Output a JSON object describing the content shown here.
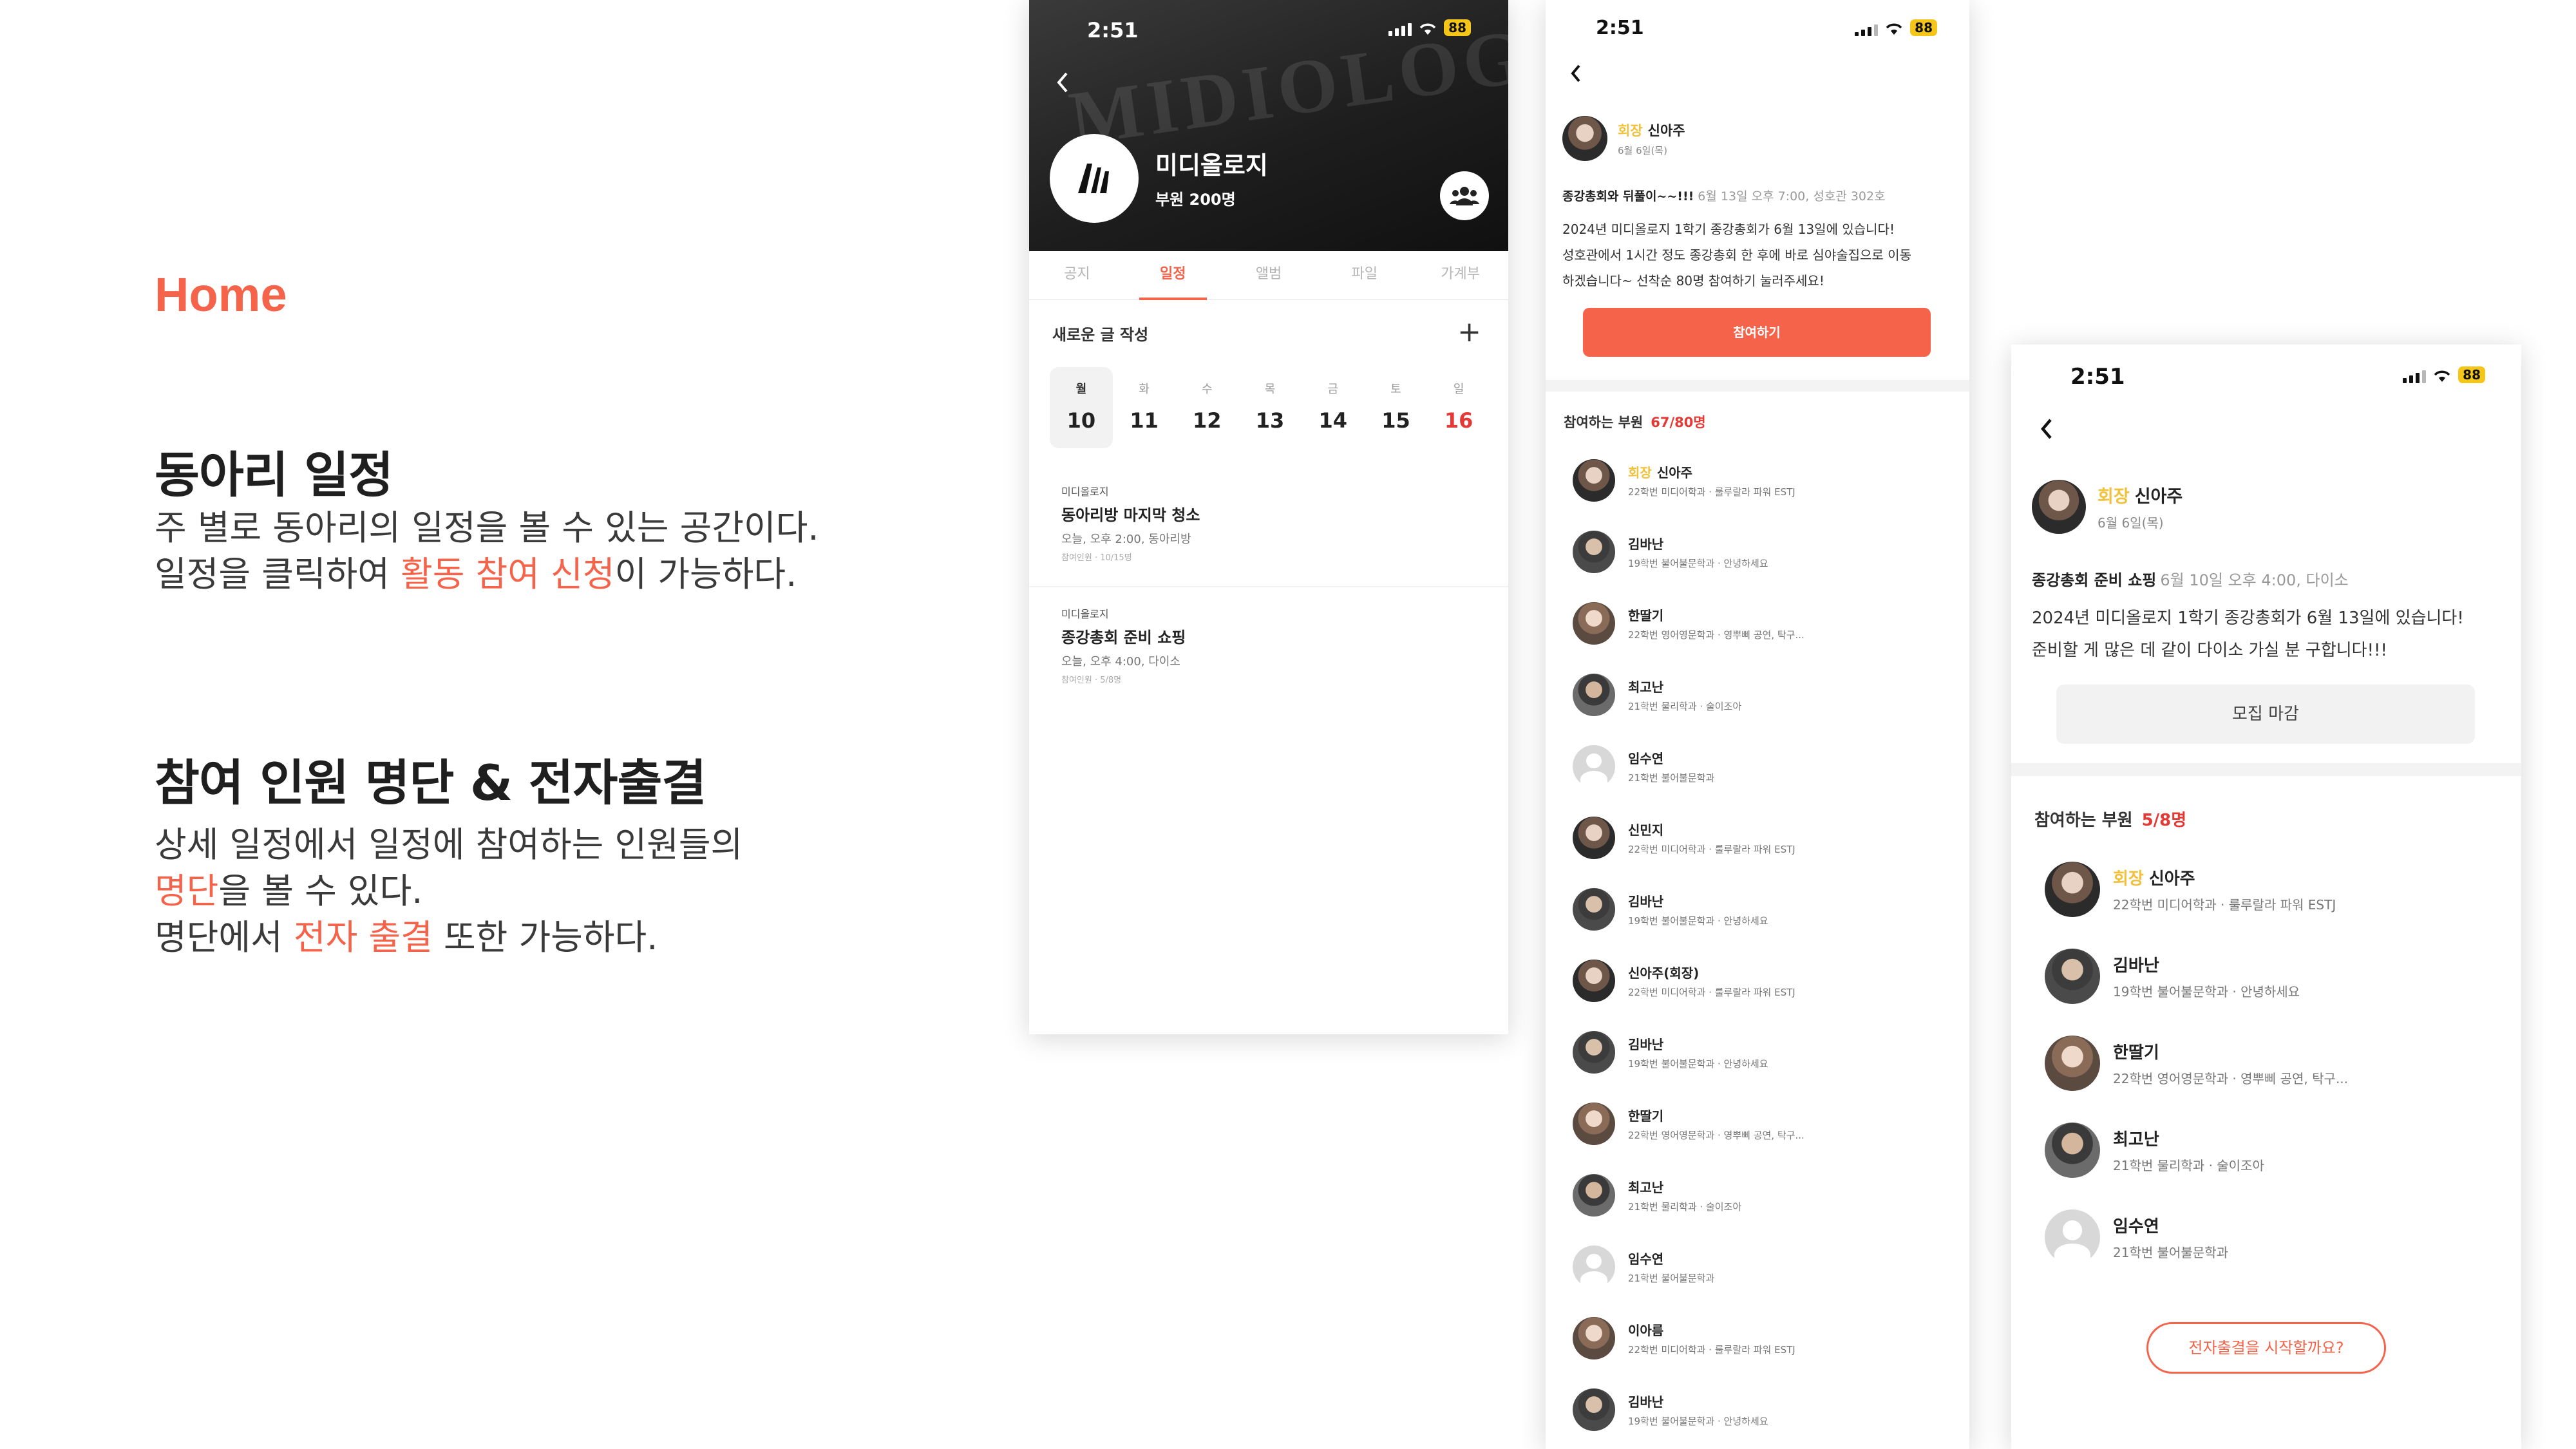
{
  "intro": {
    "section_label": "Home",
    "sections": [
      {
        "title": "동아리 일정",
        "line1": "주 별로 동아리의 일정을 볼 수 있는 공간이다.",
        "line2_before": "일정을 클릭하여 ",
        "line2_highlight": "활동 참여 신청",
        "line2_after": "이 가능하다."
      },
      {
        "title": "참여 인원 명단 & 전자출결",
        "line1": "상세 일정에서 일정에 참여하는 인원들의",
        "line2_highlight": "명단",
        "line2_after": "을 볼 수 있다.",
        "line3_before": "명단에서 ",
        "line3_highlight": "전자 출결",
        "line3_after": " 또한 가능하다."
      }
    ],
    "accent_color": "#f4634a"
  },
  "status_bar": {
    "time": "2:51",
    "battery": "88"
  },
  "club_home": {
    "club_name": "미디올로지",
    "members": "부원 200명",
    "hero_text": "MIDIOLOGY",
    "tabs": [
      "공지",
      "일정",
      "앨범",
      "파일",
      "가계부"
    ],
    "active_tab": "일정",
    "new_post": "새로운 글 작성",
    "plus": "+",
    "week": [
      {
        "name": "월",
        "date": "10"
      },
      {
        "name": "화",
        "date": "11"
      },
      {
        "name": "수",
        "date": "12"
      },
      {
        "name": "목",
        "date": "13"
      },
      {
        "name": "금",
        "date": "14"
      },
      {
        "name": "토",
        "date": "15"
      },
      {
        "name": "일",
        "date": "16"
      }
    ],
    "events": [
      {
        "club": "미디올로지",
        "title": "동아리방 마지막 청소",
        "when": "오늘, 오후 2:00, 동아리방",
        "count": "참여인원 · 10/15명"
      },
      {
        "club": "미디올로지",
        "title": "종강총회 준비 쇼핑",
        "when": "오늘, 오후 4:00, 다이소",
        "count": "참여인원 · 5/8명"
      }
    ]
  },
  "detail_open": {
    "author_role": "회장",
    "author_name": "신아주",
    "author_date": "6월 6일(목)",
    "post_title": "종강총회와 뒤풀이~~!!!",
    "post_meta": "6월 13일 오후 7:00, 성호관 302호",
    "body_line1": "2024년 미디올로지 1학기 종강총회가 6월 13일에 있습니다!",
    "body_line2": "성호관에서 1시간 정도 종강총회 한 후에 바로 심야술집으로 이동",
    "body_line3": "하겠습니다~ 선착순 80명 참여하기 눌러주세요!",
    "join_button": "참여하기",
    "list_label": "참여하는 부원",
    "list_count": "67/80명",
    "members": [
      {
        "role": "회장",
        "name": "신아주",
        "desc": "22학번 미디어학과 · 룰루랄라 파워 ESTJ"
      },
      {
        "role": "",
        "name": "김바난",
        "desc": "19학번 불어불문학과 · 안녕하세요"
      },
      {
        "role": "",
        "name": "한딸기",
        "desc": "22학번 영어영문학과 · 영뿌삐 공연, 탁구..."
      },
      {
        "role": "",
        "name": "최고난",
        "desc": "21학번 물리학과 · 술이조아"
      },
      {
        "role": "",
        "name": "임수연",
        "desc": "21학번 불어불문학과"
      },
      {
        "role": "",
        "name": "신민지",
        "desc": "22학번 미디어학과 · 룰루랄라 파워 ESTJ"
      },
      {
        "role": "",
        "name": "김바난",
        "desc": "19학번 불어불문학과 · 안녕하세요"
      },
      {
        "role": "",
        "name": "신아주(회장)",
        "desc": "22학번 미디어학과 · 룰루랄라 파워 ESTJ"
      },
      {
        "role": "",
        "name": "김바난",
        "desc": "19학번 불어불문학과 · 안녕하세요"
      },
      {
        "role": "",
        "name": "한딸기",
        "desc": "22학번 영어영문학과 · 영뿌삐 공연, 탁구..."
      },
      {
        "role": "",
        "name": "최고난",
        "desc": "21학번 물리학과 · 술이조아"
      },
      {
        "role": "",
        "name": "임수연",
        "desc": "21학번 불어불문학과"
      },
      {
        "role": "",
        "name": "이아름",
        "desc": "22학번 미디어학과 · 룰루랄라 파워 ESTJ"
      },
      {
        "role": "",
        "name": "김바난",
        "desc": "19학번 불어불문학과 · 안녕하세요"
      }
    ]
  },
  "detail_closed": {
    "author_role": "회장",
    "author_name": "신아주",
    "author_date": "6월 6일(목)",
    "post_title": "종강총회 준비 쇼핑",
    "post_meta": "6월 10일 오후 4:00, 다이소",
    "body_line1": "2024년 미디올로지 1학기 종강총회가 6월 13일에 있습니다!",
    "body_line2": "준비할 게 많은 데 같이 다이소 가실 분 구합니다!!!",
    "closed_button": "모집 마감",
    "list_label": "참여하는 부원",
    "list_count": "5/8명",
    "members": [
      {
        "role": "회장",
        "name": "신아주",
        "desc": "22학번 미디어학과 · 룰루랄라 파워 ESTJ"
      },
      {
        "role": "",
        "name": "김바난",
        "desc": "19학번 불어불문학과 · 안녕하세요"
      },
      {
        "role": "",
        "name": "한딸기",
        "desc": "22학번 영어영문학과 · 영뿌삐 공연, 탁구..."
      },
      {
        "role": "",
        "name": "최고난",
        "desc": "21학번 물리학과 · 술이조아"
      },
      {
        "role": "",
        "name": "임수연",
        "desc": "21학번 불어불문학과"
      }
    ],
    "attend_button": "전자출결을 시작할까요?"
  }
}
